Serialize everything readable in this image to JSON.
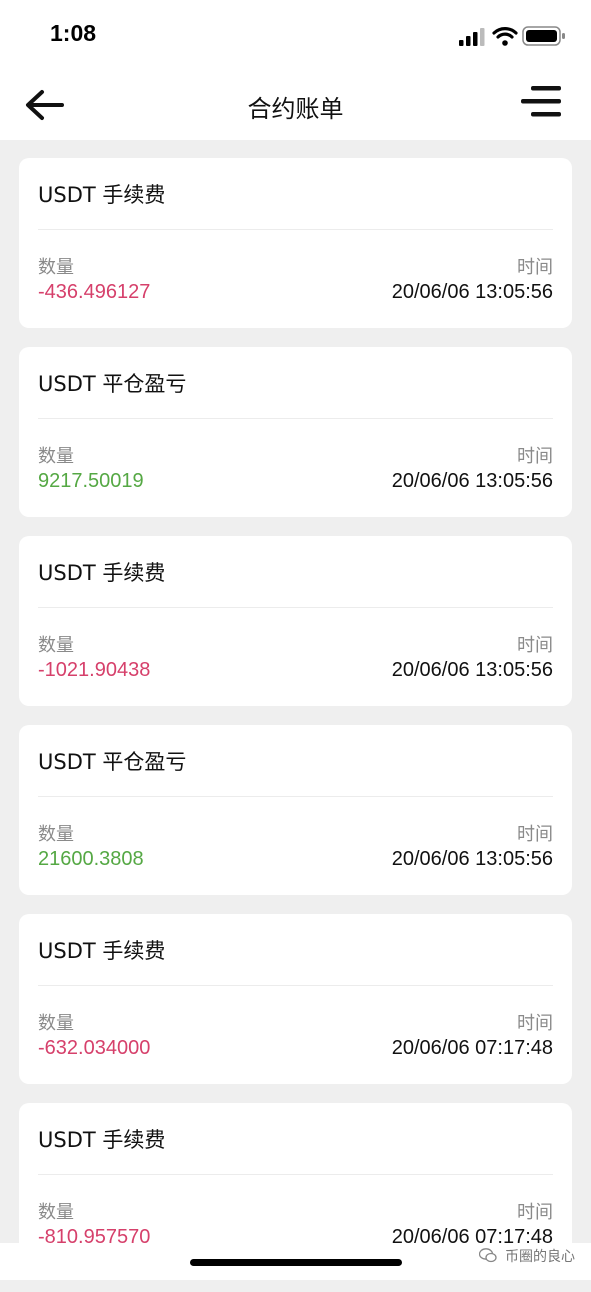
{
  "status_bar": {
    "time": "1:08",
    "icons": [
      "signal-icon",
      "wifi-icon",
      "battery-icon"
    ]
  },
  "nav": {
    "title": "合约账单",
    "back_icon": "back-arrow-icon",
    "menu_icon": "menu-icon"
  },
  "labels": {
    "amount": "数量",
    "time": "时间"
  },
  "colors": {
    "negative": "#d6406b",
    "positive": "#55a844",
    "background": "#efefef",
    "card": "#ffffff"
  },
  "records": [
    {
      "title": "USDT 手续费",
      "amount": "-436.496127",
      "sign": "negative",
      "time": "20/06/06 13:05:56"
    },
    {
      "title": "USDT 平仓盈亏",
      "amount": "9217.50019",
      "sign": "positive",
      "time": "20/06/06 13:05:56"
    },
    {
      "title": "USDT 手续费",
      "amount": "-1021.90438",
      "sign": "negative",
      "time": "20/06/06 13:05:56"
    },
    {
      "title": "USDT 平仓盈亏",
      "amount": "21600.3808",
      "sign": "positive",
      "time": "20/06/06 13:05:56"
    },
    {
      "title": "USDT 手续费",
      "amount": "-632.034000",
      "sign": "negative",
      "time": "20/06/06 07:17:48"
    },
    {
      "title": "USDT 手续费",
      "amount": "-810.957570",
      "sign": "negative",
      "time": "20/06/06 07:17:48"
    }
  ],
  "watermark": {
    "text": "币圈的良心",
    "icon": "wechat-icon"
  }
}
